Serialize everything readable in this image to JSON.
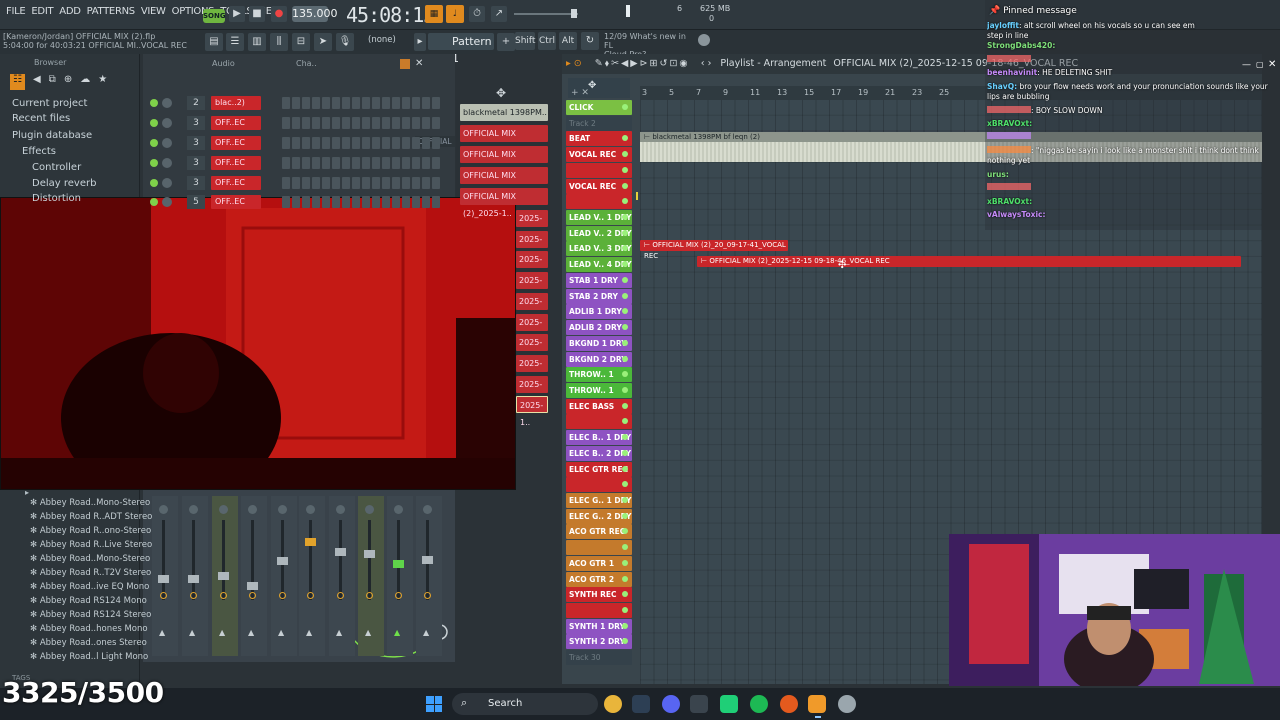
{
  "menu": [
    "FILE",
    "EDIT",
    "ADD",
    "PATTERNS",
    "VIEW",
    "OPTIONS",
    "TOOLS",
    "HELP"
  ],
  "song_mode": "SONG",
  "tempo": "135.000",
  "time": "45:08:15",
  "cpu": {
    "a": "6",
    "b": "625 MB",
    "c": "0"
  },
  "project": {
    "path": "[Kameron/Jordan]  OFFICIAL MIX (2).flp",
    "sub": "5:04:00 for 40:03:21    OFFICIAL MI..VOCAL REC"
  },
  "hint": {
    "date": "12/09",
    "line1": "What's new in FL",
    "line2": "Cloud Pro?"
  },
  "snap": "(none)",
  "pattern": "Pattern 1",
  "mode_btns": [
    "Shift",
    "Ctrl",
    "Alt"
  ],
  "browser": {
    "label": "Browser",
    "items": [
      "Current project",
      "Recent files",
      "Plugin database",
      "Effects",
      "Controller",
      "Delay reverb",
      "Distortion"
    ],
    "plugins": [
      "Abbey Road..Mono-Stereo",
      "Abbey Road R..ADT Stereo",
      "Abbey Road R..ono-Stereo",
      "Abbey Road R..Live Stereo",
      "Abbey Road..Mono-Stereo",
      "Abbey Road R..T2V Stereo",
      "Abbey Road..ive EQ Mono",
      "Abbey Road RS124 Mono",
      "Abbey Road RS124 Stereo",
      "Abbey Road..hones Mono",
      "Abbey Road..ones Stereo",
      "Abbey Road..l Light Mono"
    ],
    "tags": "TAGS"
  },
  "rack": {
    "tabs": [
      "Audio",
      "Cha.."
    ],
    "rows": [
      {
        "n": "2",
        "name": "blac..2)"
      },
      {
        "n": "3",
        "name": "OFF..EC"
      },
      {
        "n": "3",
        "name": "OFF..EC"
      },
      {
        "n": "3",
        "name": "OFF..EC"
      },
      {
        "n": "3",
        "name": "OFF..EC"
      },
      {
        "n": "5",
        "name": "OFF..EC"
      }
    ]
  },
  "picker": [
    "blackmetal 1398PM..",
    "OFFICIAL MIX (2)_2025-1..",
    "OFFICIAL MIX (2)_2025-1..",
    "OFFICIAL MIX (2)_2025-1..",
    "OFFICIAL MIX (2)_2025-1..",
    "2025-1..",
    "2025-1..",
    "2025-1..",
    "2025-1..",
    "2025-1..",
    "2025-1..",
    "2025-1..",
    "2025-1..",
    "2025-1..",
    "2025-1.."
  ],
  "picker_ghost": "OFFICIAL",
  "playlist": {
    "title": "Playlist - Arrangement",
    "crumb": "OFFICIAL MIX (2)_2025-12-15 09-18-46_VOCAL REC",
    "ruler": [
      "3",
      "5",
      "7",
      "9",
      "11",
      "13",
      "15",
      "17",
      "19",
      "21",
      "23",
      "25"
    ],
    "tracks": [
      {
        "name": "CLICK",
        "color": "#7bc043"
      },
      {
        "name": "Track 2",
        "color": ""
      },
      {
        "name": "BEAT",
        "color": "#c9262a"
      },
      {
        "name": "VOCAL REC",
        "color": "#c9262a"
      },
      {
        "name": "",
        "color": "#c9262a"
      },
      {
        "name": "VOCAL REC",
        "color": "#c9262a"
      },
      {
        "name": "",
        "color": "#c9262a"
      },
      {
        "name": "LEAD V.. 1 DRY",
        "color": "#5bb139"
      },
      {
        "name": "LEAD V.. 2 DRY",
        "color": "#5bb139"
      },
      {
        "name": "LEAD V.. 3 DRY",
        "color": "#5bb139"
      },
      {
        "name": "LEAD V.. 4 DRY",
        "color": "#5bb139"
      },
      {
        "name": "STAB 1 DRY",
        "color": "#8e53c2"
      },
      {
        "name": "STAB 2 DRY",
        "color": "#8e53c2"
      },
      {
        "name": "ADLIB 1 DRY",
        "color": "#8e53c2"
      },
      {
        "name": "ADLIB 2 DRY",
        "color": "#8e53c2"
      },
      {
        "name": "BKGND 1 DRY",
        "color": "#8e53c2"
      },
      {
        "name": "BKGND 2 DRY",
        "color": "#8e53c2"
      },
      {
        "name": "THROW.. 1 DRY",
        "color": "#4bb83a"
      },
      {
        "name": "THROW.. 1 DRY",
        "color": "#4bb83a"
      },
      {
        "name": "ELEC BASS REC",
        "color": "#c9262a"
      },
      {
        "name": "",
        "color": "#c9262a"
      },
      {
        "name": "ELEC B.. 1 DRY",
        "color": "#8e53c2"
      },
      {
        "name": "ELEC B.. 2 DRY",
        "color": "#8e53c2"
      },
      {
        "name": "ELEC GTR REC",
        "color": "#c9262a"
      },
      {
        "name": "",
        "color": "#c9262a"
      },
      {
        "name": "ELEC G.. 1 DRY",
        "color": "#c47a2c"
      },
      {
        "name": "ELEC G.. 2 DRY",
        "color": "#c47a2c"
      },
      {
        "name": "ACO GTR REC",
        "color": "#c47a2c"
      },
      {
        "name": "",
        "color": "#c47a2c"
      },
      {
        "name": "ACO GTR 1 DRY",
        "color": "#c47a2c"
      },
      {
        "name": "ACO GTR 2 DRY",
        "color": "#c47a2c"
      },
      {
        "name": "SYNTH REC",
        "color": "#c9262a"
      },
      {
        "name": "",
        "color": "#c9262a"
      },
      {
        "name": "SYNTH 1 DRY",
        "color": "#8e53c2"
      },
      {
        "name": "SYNTH 2 DRY",
        "color": "#8e53c2"
      },
      {
        "name": "Track 30",
        "color": ""
      }
    ],
    "clips": {
      "beat": "blackmetal 1398PM bf leqn (2)",
      "vocal1": "OFFICIAL MIX (2)_20_09-17-41_VOCAL REC",
      "vocal2": "OFFICIAL MIX (2)_2025-12-15 09-18-46_VOCAL REC"
    }
  },
  "chat": {
    "header": "Pinned message",
    "pinned": {
      "user": "jayloffit",
      "msg": ": alt scroll wheel on his vocals so u can see em"
    },
    "pinned2": "step in line",
    "lines": [
      {
        "user": "StrongDabs420:",
        "msg": "",
        "color": "#7fe07a"
      },
      {
        "user": "",
        "msg": "",
        "color": "#ff6a6a"
      },
      {
        "user": "beenhavinit",
        "msg": ": HE DELETING SHIT",
        "color": "#c58af9"
      },
      {
        "user": "ShavQ:",
        "msg": " bro your flow needs work and your pronunciation sounds like your lips are bubbling",
        "color": "#68d0ff"
      },
      {
        "user": "",
        "msg": ": BOY SLOW DOWN",
        "color": "#ff6a6a"
      },
      {
        "user": "xBRAVOxt:",
        "msg": "",
        "color": "#4ee06a"
      },
      {
        "user": "",
        "msg": "",
        "color": "#c58af9"
      },
      {
        "user": "",
        "msg": ": \"niggas be sayin i look like a monster shit i think dont think nothing yet",
        "color": "#ff8a3a"
      },
      {
        "user": "urus:",
        "msg": "",
        "color": "#7fe07a"
      },
      {
        "user": "",
        "msg": "",
        "color": "#ff6a6a"
      },
      {
        "user": "xBRAVOxt:",
        "msg": "",
        "color": "#4ee06a"
      },
      {
        "user": "vAlwaysToxic:",
        "msg": "",
        "color": "#c58af9"
      }
    ]
  },
  "taskbar": {
    "search": "Search"
  },
  "counter": "3325/3500"
}
